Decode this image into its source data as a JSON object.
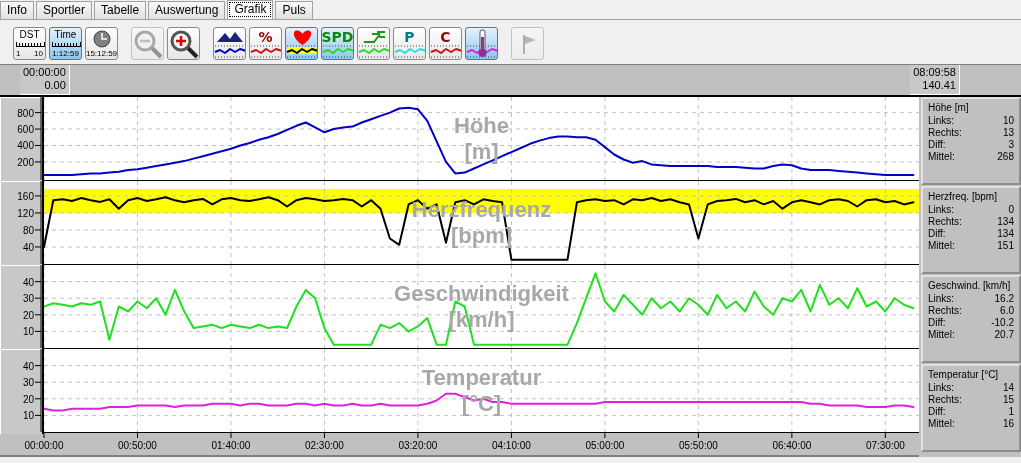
{
  "tabs": [
    {
      "label": "Info",
      "selected": false
    },
    {
      "label": "Sportler",
      "selected": false
    },
    {
      "label": "Tabelle",
      "selected": false
    },
    {
      "label": "Auswertung",
      "selected": false
    },
    {
      "label": "Grafik",
      "selected": true
    },
    {
      "label": "Puls",
      "selected": false
    }
  ],
  "toolbar_groups": [
    {
      "buttons": [
        {
          "kind": "ruler",
          "label": "DST",
          "scale": [
            "1",
            "10"
          ],
          "selected": false,
          "disabled": false
        },
        {
          "kind": "ruler",
          "label": "Time",
          "scale": [
            "1:12:59"
          ],
          "selected": true,
          "disabled": false
        },
        {
          "kind": "clock",
          "scale": [
            "15:12:59"
          ],
          "selected": false,
          "disabled": false
        }
      ]
    },
    {
      "buttons": [
        {
          "kind": "zoom-out",
          "selected": false,
          "disabled": true
        },
        {
          "kind": "zoom-in",
          "selected": false,
          "disabled": false
        }
      ]
    },
    {
      "buttons": [
        {
          "kind": "height",
          "color": "#0000c8",
          "selected": false,
          "disabled": false
        },
        {
          "kind": "percent",
          "label": "%",
          "color": "#d01010",
          "selected": false,
          "disabled": false
        },
        {
          "kind": "heart",
          "color": "#000000",
          "selected": true,
          "disabled": false
        },
        {
          "kind": "speed",
          "label": "SPD",
          "color": "#20e020",
          "selected": true,
          "disabled": false
        },
        {
          "kind": "cadence",
          "color": "#20e020",
          "selected": false,
          "disabled": false
        },
        {
          "kind": "power",
          "label": "P",
          "color": "#20e0e0",
          "selected": false,
          "disabled": false
        },
        {
          "kind": "c-channel",
          "label": "C",
          "color": "#d01010",
          "selected": false,
          "disabled": false
        },
        {
          "kind": "temperature",
          "color": "#e020e0",
          "selected": true,
          "disabled": false
        }
      ]
    },
    {
      "buttons": [
        {
          "kind": "flag",
          "selected": false,
          "disabled": true
        }
      ]
    }
  ],
  "range": {
    "start_time": "00:00:00",
    "start_distance": "0.00",
    "end_time": "08:09:58",
    "end_distance": "140.41"
  },
  "panels": [
    {
      "stats": {
        "heading": "Höhe [m]",
        "rows": [
          {
            "label": "Links:",
            "value": "10"
          },
          {
            "label": "Rechts:",
            "value": "13"
          },
          {
            "label": "Diff:",
            "value": "3"
          },
          {
            "label": "Mittel:",
            "value": "268"
          }
        ]
      },
      "chart_data": {
        "type": "line",
        "title": "Höhe",
        "ylabel": "[m]",
        "grid": true,
        "xlim": [
          0,
          468
        ],
        "ylim": [
          -20,
          990
        ],
        "yticks": [
          {
            "value": 200,
            "label": "200"
          },
          {
            "value": 400,
            "label": "400"
          },
          {
            "value": 600,
            "label": "600"
          },
          {
            "value": 800,
            "label": "800"
          }
        ],
        "x": [
          0,
          5,
          10,
          15,
          20,
          25,
          30,
          35,
          40,
          45,
          50,
          55,
          60,
          65,
          70,
          75,
          80,
          85,
          90,
          95,
          100,
          105,
          110,
          115,
          120,
          125,
          130,
          135,
          140,
          145,
          150,
          155,
          160,
          165,
          170,
          175,
          180,
          185,
          190,
          195,
          200,
          205,
          210,
          215,
          220,
          225,
          230,
          235,
          240,
          245,
          250,
          255,
          260,
          265,
          270,
          275,
          280,
          285,
          290,
          295,
          300,
          305,
          310,
          315,
          320,
          325,
          330,
          335,
          340,
          345,
          350,
          355,
          360,
          365,
          370,
          375,
          380,
          385,
          390,
          395,
          400,
          405,
          410,
          415,
          420,
          425,
          430,
          435,
          440,
          445,
          450,
          455,
          460,
          465
        ],
        "series": [
          {
            "color": "#0000c8",
            "values": [
              40,
              40,
              40,
              40,
              50,
              60,
              60,
              70,
              80,
              100,
              110,
              130,
              150,
              170,
              190,
              210,
              240,
              270,
              300,
              330,
              360,
              400,
              430,
              470,
              500,
              540,
              590,
              640,
              680,
              620,
              560,
              600,
              620,
              630,
              680,
              720,
              760,
              800,
              850,
              860,
              840,
              700,
              450,
              200,
              60,
              70,
              120,
              170,
              220,
              270,
              320,
              370,
              420,
              460,
              490,
              510,
              510,
              500,
              500,
              470,
              380,
              290,
              230,
              190,
              210,
              170,
              160,
              150,
              150,
              150,
              150,
              150,
              140,
              140,
              140,
              130,
              120,
              120,
              150,
              170,
              160,
              120,
              100,
              100,
              100,
              90,
              80,
              70,
              60,
              50,
              40,
              40,
              40,
              40
            ]
          }
        ]
      }
    },
    {
      "stats": {
        "heading": "Herzfreq. [bpm]",
        "rows": [
          {
            "label": "Links:",
            "value": "0"
          },
          {
            "label": "Rechts:",
            "value": "134"
          },
          {
            "label": "Diff:",
            "value": "134"
          },
          {
            "label": "Mittel:",
            "value": "151"
          }
        ]
      },
      "chart_data": {
        "type": "line",
        "title": "Herzfrequenz",
        "ylabel": "[bpm]",
        "grid": true,
        "xlim": [
          0,
          468
        ],
        "ylim": [
          0,
          195
        ],
        "yticks": [
          {
            "value": 40,
            "label": "40"
          },
          {
            "value": 80,
            "label": "80"
          },
          {
            "value": 120,
            "label": "120"
          },
          {
            "value": 160,
            "label": "160"
          }
        ],
        "bands": [
          {
            "axis": "y",
            "from": 120,
            "to": 176,
            "color": "#ffff00"
          }
        ],
        "x": [
          0,
          5,
          10,
          15,
          20,
          25,
          30,
          35,
          40,
          45,
          50,
          55,
          60,
          65,
          70,
          75,
          80,
          85,
          90,
          95,
          100,
          105,
          110,
          115,
          120,
          125,
          130,
          135,
          140,
          145,
          150,
          155,
          160,
          165,
          170,
          175,
          180,
          185,
          190,
          195,
          200,
          205,
          210,
          215,
          220,
          225,
          230,
          235,
          240,
          245,
          250,
          255,
          260,
          265,
          270,
          275,
          280,
          285,
          290,
          295,
          300,
          305,
          310,
          315,
          320,
          325,
          330,
          335,
          340,
          345,
          350,
          355,
          360,
          365,
          370,
          375,
          380,
          385,
          390,
          395,
          400,
          405,
          410,
          415,
          420,
          425,
          430,
          435,
          440,
          445,
          450,
          455,
          460,
          465
        ],
        "series": [
          {
            "color": "#000000",
            "values": [
              40,
              150,
              152,
              148,
              155,
              150,
              146,
              152,
              130,
              150,
              155,
              148,
              152,
              157,
              150,
              145,
              150,
              153,
              140,
              152,
              155,
              150,
              148,
              152,
              157,
              150,
              135,
              150,
              155,
              152,
              148,
              150,
              153,
              150,
              135,
              150,
              130,
              60,
              45,
              140,
              150,
              130,
              140,
              50,
              145,
              150,
              140,
              152,
              148,
              145,
              10,
              10,
              10,
              10,
              10,
              10,
              10,
              145,
              150,
              152,
              148,
              150,
              140,
              152,
              150,
              155,
              148,
              152,
              145,
              140,
              60,
              140,
              148,
              150,
              153,
              145,
              150,
              140,
              148,
              130,
              145,
              150,
              145,
              140,
              150,
              152,
              148,
              135,
              150,
              152,
              145,
              148,
              140,
              145
            ]
          }
        ]
      }
    },
    {
      "stats": {
        "heading": "Geschwind. [km/h]",
        "rows": [
          {
            "label": "Links:",
            "value": "16.2"
          },
          {
            "label": "Rechts:",
            "value": "6.0"
          },
          {
            "label": "Diff:",
            "value": "-10.2"
          },
          {
            "label": "Mittel:",
            "value": "20.7"
          }
        ]
      },
      "chart_data": {
        "type": "line",
        "title": "Geschwindigkeit",
        "ylabel": "[km/h]",
        "grid": true,
        "xlim": [
          0,
          468
        ],
        "ylim": [
          0,
          50
        ],
        "yticks": [
          {
            "value": 10,
            "label": "10"
          },
          {
            "value": 20,
            "label": "20"
          },
          {
            "value": 30,
            "label": "30"
          },
          {
            "value": 40,
            "label": "40"
          }
        ],
        "x": [
          0,
          5,
          10,
          15,
          20,
          25,
          30,
          35,
          40,
          45,
          50,
          55,
          60,
          65,
          70,
          75,
          80,
          85,
          90,
          95,
          100,
          105,
          110,
          115,
          120,
          125,
          130,
          135,
          140,
          145,
          150,
          155,
          160,
          165,
          170,
          175,
          180,
          185,
          190,
          195,
          200,
          205,
          210,
          215,
          220,
          225,
          230,
          235,
          240,
          245,
          250,
          255,
          260,
          265,
          270,
          275,
          280,
          285,
          290,
          295,
          300,
          305,
          310,
          315,
          320,
          325,
          330,
          335,
          340,
          345,
          350,
          355,
          360,
          365,
          370,
          375,
          380,
          385,
          390,
          395,
          400,
          405,
          410,
          415,
          420,
          425,
          430,
          435,
          440,
          445,
          450,
          455,
          460,
          465
        ],
        "series": [
          {
            "color": "#20e020",
            "values": [
              25,
              27,
              26,
              25,
              27,
              26,
              28,
              5,
              25,
              22,
              28,
              24,
              30,
              20,
              35,
              22,
              12,
              13,
              14,
              12,
              14,
              13,
              12,
              14,
              12,
              13,
              12,
              25,
              35,
              30,
              12,
              2,
              2,
              2,
              2,
              2,
              14,
              12,
              15,
              10,
              13,
              18,
              2,
              2,
              28,
              25,
              2,
              2,
              2,
              2,
              2,
              2,
              2,
              2,
              2,
              2,
              2,
              15,
              30,
              45,
              28,
              22,
              32,
              26,
              20,
              30,
              24,
              28,
              22,
              30,
              26,
              20,
              32,
              24,
              28,
              22,
              34,
              25,
              20,
              30,
              28,
              35,
              22,
              38,
              26,
              30,
              24,
              36,
              25,
              28,
              22,
              30,
              26,
              24
            ]
          }
        ]
      }
    },
    {
      "stats": {
        "heading": "Temperatur [°C]",
        "rows": [
          {
            "label": "Links:",
            "value": "14"
          },
          {
            "label": "Rechts:",
            "value": "15"
          },
          {
            "label": "Diff:",
            "value": "1"
          },
          {
            "label": "Mittel:",
            "value": "16"
          }
        ]
      },
      "chart_data": {
        "type": "line",
        "title": "Temperatur",
        "ylabel": "[°C]",
        "grid": true,
        "xlim": [
          0,
          468
        ],
        "xticks": [
          {
            "value": 0,
            "label": "00:00:00"
          },
          {
            "value": 50,
            "label": "00:50:00"
          },
          {
            "value": 100,
            "label": "01:40:00"
          },
          {
            "value": 150,
            "label": "02:30:00"
          },
          {
            "value": 200,
            "label": "03:20:00"
          },
          {
            "value": 250,
            "label": "04:10:00"
          },
          {
            "value": 300,
            "label": "05:00:00"
          },
          {
            "value": 350,
            "label": "05:50:00"
          },
          {
            "value": 400,
            "label": "06:40:00"
          },
          {
            "value": 450,
            "label": "07:30:00"
          }
        ],
        "ylim": [
          0,
          50
        ],
        "yticks": [
          {
            "value": 10,
            "label": "10"
          },
          {
            "value": 20,
            "label": "20"
          },
          {
            "value": 30,
            "label": "30"
          },
          {
            "value": 40,
            "label": "40"
          }
        ],
        "x": [
          0,
          5,
          10,
          15,
          20,
          25,
          30,
          35,
          40,
          45,
          50,
          55,
          60,
          65,
          70,
          75,
          80,
          85,
          90,
          95,
          100,
          105,
          110,
          115,
          120,
          125,
          130,
          135,
          140,
          145,
          150,
          155,
          160,
          165,
          170,
          175,
          180,
          185,
          190,
          195,
          200,
          205,
          210,
          215,
          220,
          225,
          230,
          235,
          240,
          245,
          250,
          255,
          260,
          265,
          270,
          275,
          280,
          285,
          290,
          295,
          300,
          305,
          310,
          315,
          320,
          325,
          330,
          335,
          340,
          345,
          350,
          355,
          360,
          365,
          370,
          375,
          380,
          385,
          390,
          395,
          400,
          405,
          410,
          415,
          420,
          425,
          430,
          435,
          440,
          445,
          450,
          455,
          460,
          465
        ],
        "series": [
          {
            "color": "#e020e0",
            "values": [
              14,
              13,
              13,
              14,
              14,
              14,
              14,
              15,
              15,
              15,
              16,
              16,
              16,
              16,
              15,
              16,
              16,
              16,
              17,
              17,
              17,
              16,
              17,
              17,
              16,
              16,
              16,
              17,
              17,
              16,
              17,
              16,
              16,
              17,
              16,
              16,
              17,
              16,
              16,
              16,
              16,
              17,
              19,
              23,
              23,
              21,
              19,
              20,
              18,
              18,
              17,
              17,
              17,
              17,
              17,
              17,
              17,
              17,
              17,
              17,
              18,
              18,
              18,
              18,
              18,
              18,
              18,
              18,
              18,
              18,
              18,
              18,
              18,
              18,
              18,
              18,
              18,
              18,
              18,
              18,
              18,
              18,
              17,
              17,
              16,
              16,
              16,
              16,
              15,
              15,
              15,
              16,
              16,
              15
            ]
          }
        ]
      }
    }
  ]
}
